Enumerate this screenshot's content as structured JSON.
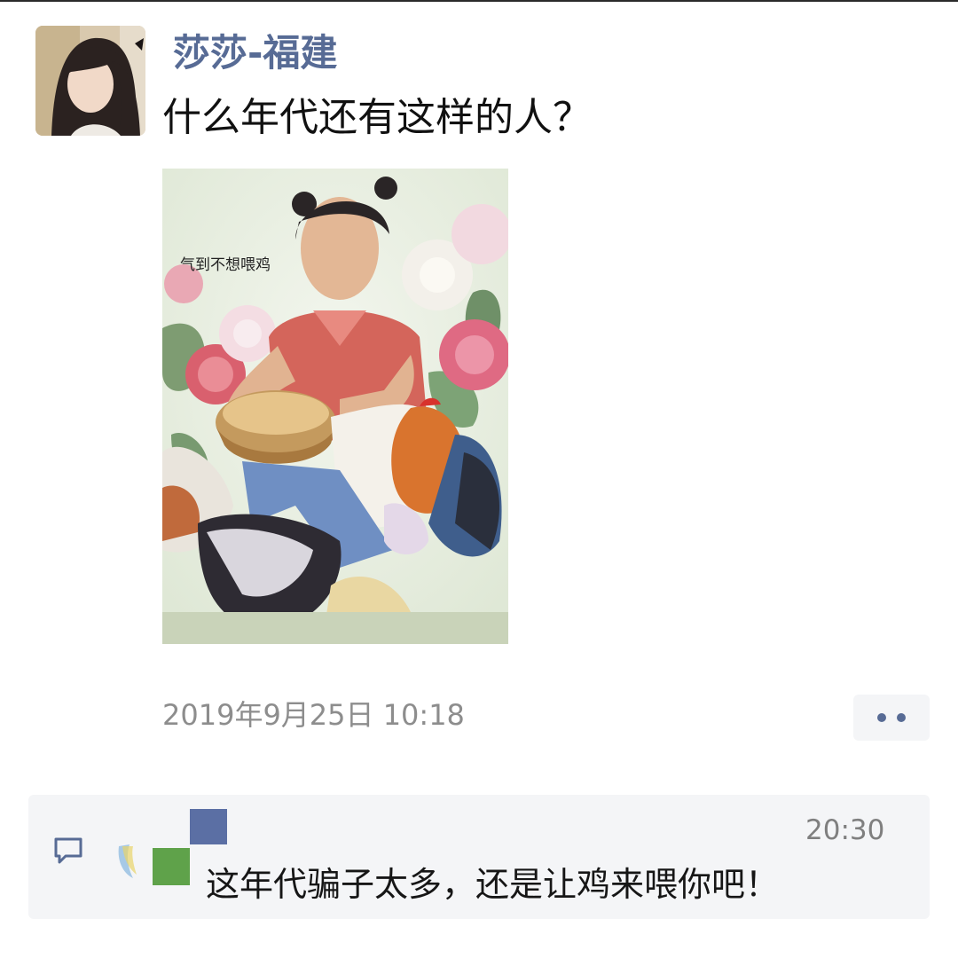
{
  "post": {
    "author": "莎莎-福建",
    "text": "什么年代还有这样的人？",
    "image_caption": "气到不想喂鸡",
    "timestamp": "2019年9月25日 10:18"
  },
  "comment": {
    "time": "20:30",
    "text": "这年代骗子太多，还是让鸡来喂你吧！"
  },
  "icons": {
    "more": "more-dots-icon",
    "comment": "comment-bubble-icon"
  },
  "colors": {
    "author_name": "#576b95",
    "timestamp": "#8d8d8d",
    "comment_background": "#f4f5f7"
  }
}
